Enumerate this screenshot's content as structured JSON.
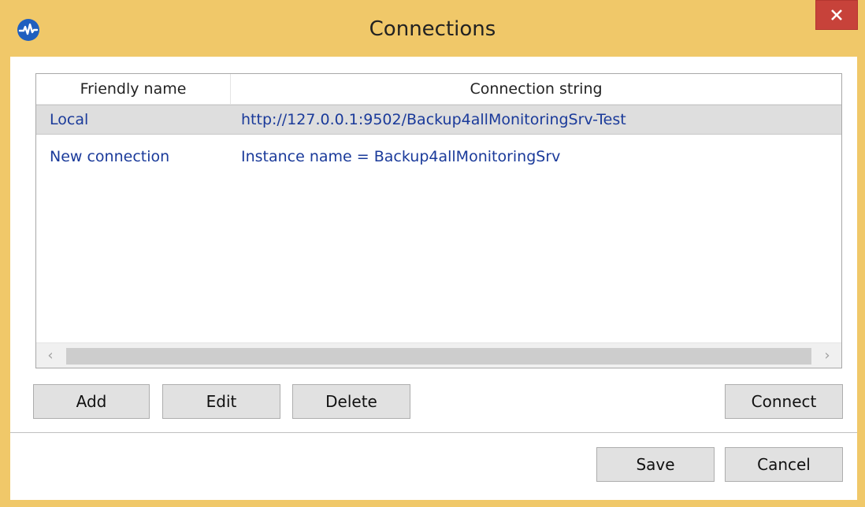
{
  "window": {
    "title": "Connections",
    "app_icon": "activity-pulse-icon",
    "close_icon": "close-icon",
    "colors": {
      "frame": "#f0c869",
      "close": "#c7423a",
      "link_text": "#1a3a9a"
    }
  },
  "grid": {
    "columns": [
      "Friendly name",
      "Connection string"
    ],
    "rows": [
      {
        "name": "Local",
        "connection": "http://127.0.0.1:9502/Backup4allMonitoringSrv-Test",
        "selected": true
      },
      {
        "name": "New connection",
        "connection": "Instance name = Backup4allMonitoringSrv",
        "selected": false
      }
    ],
    "scroll_left_icon": "chevron-left-icon",
    "scroll_right_icon": "chevron-right-icon"
  },
  "buttons": {
    "add": "Add",
    "edit": "Edit",
    "delete": "Delete",
    "connect": "Connect",
    "save": "Save",
    "cancel": "Cancel"
  }
}
